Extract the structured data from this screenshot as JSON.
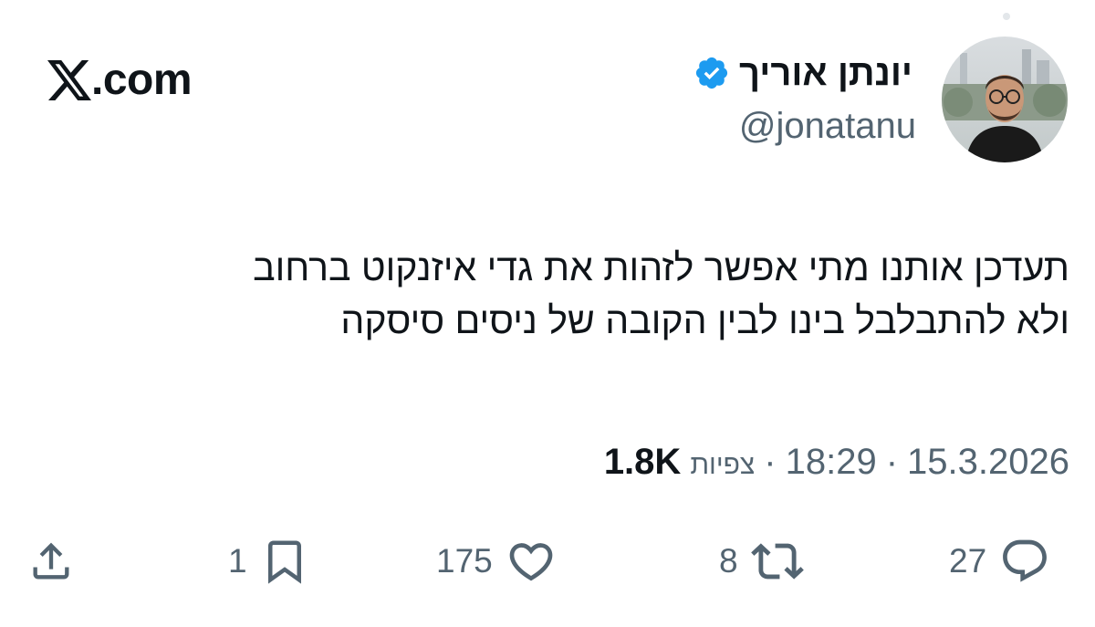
{
  "brand": {
    "site": "X.com",
    "x_mark": "𝕏",
    "wordmark": ".com"
  },
  "author": {
    "name": "יונתן אוריך",
    "handle": "@jonatanu",
    "verified": true,
    "verified_color": "#1d9bf0"
  },
  "tweet": {
    "lines": [
      "תעדכן אותנו מתי אפשר לזהות את גדי איזנקוט ברחוב",
      "ולא להתבלבל בינו לבין הקובה של ניסים סיסקה"
    ]
  },
  "meta": {
    "date": "15.3.2026",
    "separator": "·",
    "time": "18:29",
    "views_label": "צפיות",
    "views_count": "1.8K"
  },
  "actions": {
    "reply": {
      "icon": "reply-icon",
      "count": "27"
    },
    "repost": {
      "icon": "repost-icon",
      "count": "8"
    },
    "like": {
      "icon": "heart-icon",
      "count": "175"
    },
    "bookmark": {
      "icon": "bookmark-icon",
      "count": "1"
    },
    "share": {
      "icon": "share-icon"
    }
  },
  "colors": {
    "text": "#0f1419",
    "secondary": "#536471",
    "accent": "#1d9bf0"
  }
}
